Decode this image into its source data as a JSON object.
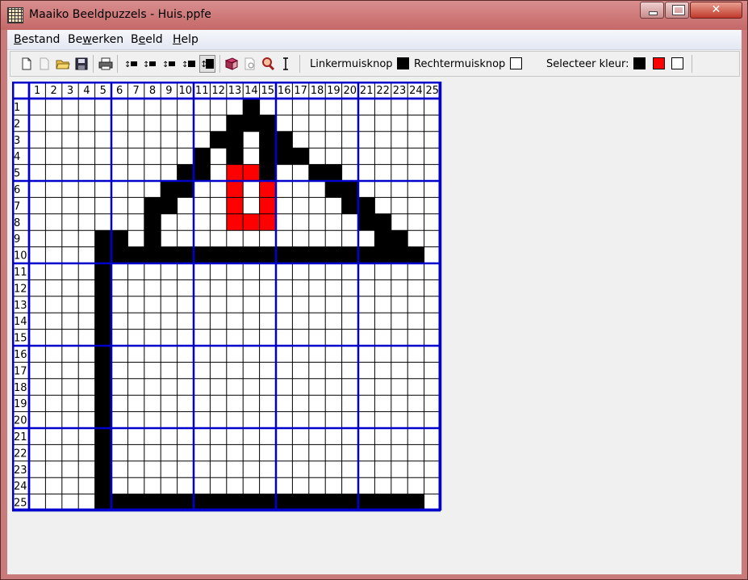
{
  "window": {
    "title": "Maaiko Beeldpuzzels - Huis.ppfe",
    "icon": "puzzle-grid-icon"
  },
  "menu": [
    {
      "pre": "",
      "acc": "B",
      "post": "estand"
    },
    {
      "pre": "Be",
      "acc": "w",
      "post": "erken"
    },
    {
      "pre": "B",
      "acc": "e",
      "post": "eld"
    },
    {
      "pre": "",
      "acc": "H",
      "post": "elp"
    }
  ],
  "toolbar": {
    "left_mouse_label": "Linkermuisknop",
    "right_mouse_label": "Rechtermuisknop",
    "select_color_label": "Selecteer kleur:",
    "left_mouse_color": "#000000",
    "right_mouse_color": "#ffffff",
    "palette": [
      "#000000",
      "#ff0000",
      "#ffffff"
    ],
    "icons": [
      "new-file-icon",
      "new-disabled-icon",
      "open-folder-icon",
      "save-icon",
      "print-icon",
      "insert-row-icon",
      "insert-column-icon",
      "delete-row-icon",
      "delete-column-icon",
      "grid-size-icon",
      "book-icon",
      "preview-icon",
      "zoom-icon",
      "text-cursor-icon"
    ]
  },
  "grid": {
    "columns": [
      "1",
      "2",
      "3",
      "4",
      "5",
      "6",
      "7",
      "8",
      "9",
      "10",
      "11",
      "12",
      "13",
      "14",
      "15",
      "16",
      "17",
      "18",
      "19",
      "20",
      "21",
      "22",
      "23",
      "24",
      "25"
    ],
    "rows": [
      "1",
      "2",
      "3",
      "4",
      "5",
      "6",
      "7",
      "8",
      "9",
      "10",
      "11",
      "12",
      "13",
      "14",
      "15",
      "16",
      "17",
      "18",
      "19",
      "20",
      "21",
      "22",
      "23",
      "24",
      "25"
    ],
    "colors": {
      "B": "#000000",
      "R": "#ff0000",
      "W": "#ffffff",
      "line": "#000000",
      "block_line": "#0000cc"
    },
    "cells": [
      ".............B...........",
      "............BBB..........",
      "...........BB.BB.........",
      "..........B.B.BBB........",
      ".........BB.RRB..BB......",
      "........BB..R.R...BB.....",
      ".......BB...R.R....BB....",
      ".......B....RRR.....BB...",
      "....BB.B.............BB..",
      "....BBBBBBBBBBBBBBBBBBBB.",
      "....B....................",
      "....B....................",
      "....B....................",
      "....B....................",
      "....B....................",
      "....B....................",
      "....B....................",
      "....B....................",
      "....B....................",
      "....B....................",
      "....B....................",
      "....B....................",
      "....B....................",
      "....B....................",
      "....BBBBBBBBBBBBBBBBBBBB."
    ]
  }
}
